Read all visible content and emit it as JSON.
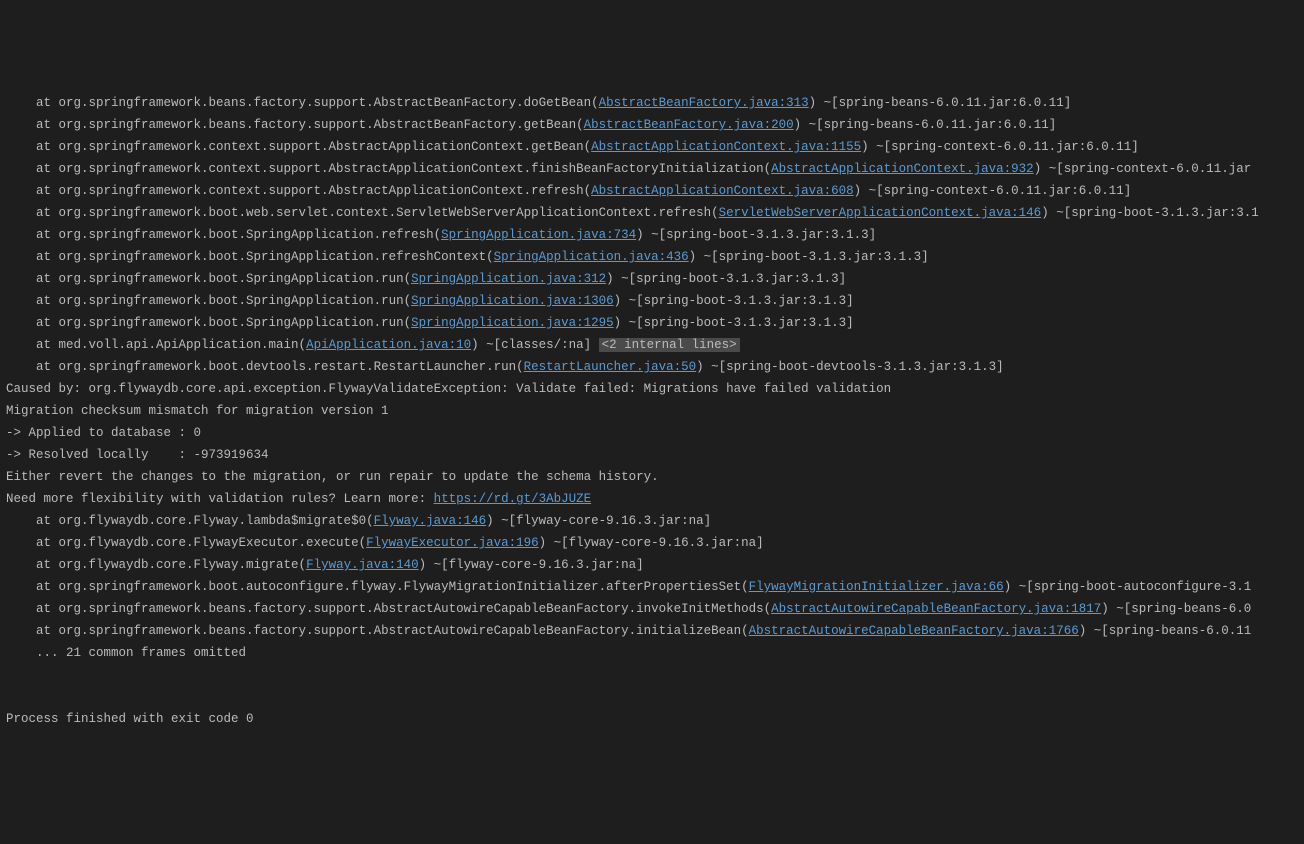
{
  "stacktrace": [
    {
      "indent": "    at ",
      "method": "org.springframework.beans.factory.support.AbstractBeanFactory.doGetBean(",
      "link": "AbstractBeanFactory.java:313",
      "suffix": ") ~[spring-beans-6.0.11.jar:6.0.11]"
    },
    {
      "indent": "    at ",
      "method": "org.springframework.beans.factory.support.AbstractBeanFactory.getBean(",
      "link": "AbstractBeanFactory.java:200",
      "suffix": ") ~[spring-beans-6.0.11.jar:6.0.11]"
    },
    {
      "indent": "    at ",
      "method": "org.springframework.context.support.AbstractApplicationContext.getBean(",
      "link": "AbstractApplicationContext.java:1155",
      "suffix": ") ~[spring-context-6.0.11.jar:6.0.11]"
    },
    {
      "indent": "    at ",
      "method": "org.springframework.context.support.AbstractApplicationContext.finishBeanFactoryInitialization(",
      "link": "AbstractApplicationContext.java:932",
      "suffix": ") ~[spring-context-6.0.11.jar"
    },
    {
      "indent": "    at ",
      "method": "org.springframework.context.support.AbstractApplicationContext.refresh(",
      "link": "AbstractApplicationContext.java:608",
      "suffix": ") ~[spring-context-6.0.11.jar:6.0.11]"
    },
    {
      "indent": "    at ",
      "method": "org.springframework.boot.web.servlet.context.ServletWebServerApplicationContext.refresh(",
      "link": "ServletWebServerApplicationContext.java:146",
      "suffix": ") ~[spring-boot-3.1.3.jar:3.1"
    },
    {
      "indent": "    at ",
      "method": "org.springframework.boot.SpringApplication.refresh(",
      "link": "SpringApplication.java:734",
      "suffix": ") ~[spring-boot-3.1.3.jar:3.1.3]"
    },
    {
      "indent": "    at ",
      "method": "org.springframework.boot.SpringApplication.refreshContext(",
      "link": "SpringApplication.java:436",
      "suffix": ") ~[spring-boot-3.1.3.jar:3.1.3]"
    },
    {
      "indent": "    at ",
      "method": "org.springframework.boot.SpringApplication.run(",
      "link": "SpringApplication.java:312",
      "suffix": ") ~[spring-boot-3.1.3.jar:3.1.3]"
    },
    {
      "indent": "    at ",
      "method": "org.springframework.boot.SpringApplication.run(",
      "link": "SpringApplication.java:1306",
      "suffix": ") ~[spring-boot-3.1.3.jar:3.1.3]"
    },
    {
      "indent": "    at ",
      "method": "org.springframework.boot.SpringApplication.run(",
      "link": "SpringApplication.java:1295",
      "suffix": ") ~[spring-boot-3.1.3.jar:3.1.3]"
    }
  ],
  "mainLine": {
    "indent": "    at ",
    "method": "med.voll.api.ApiApplication.main(",
    "link": "ApiApplication.java:10",
    "suffix": ") ~[classes/:na] ",
    "collapsed": "<2 internal lines>"
  },
  "restartLine": {
    "indent": "    at ",
    "method": "org.springframework.boot.devtools.restart.RestartLauncher.run(",
    "link": "RestartLauncher.java:50",
    "suffix": ") ~[spring-boot-devtools-3.1.3.jar:3.1.3]"
  },
  "causedBy": [
    "Caused by: org.flywaydb.core.api.exception.FlywayValidateException: Validate failed: Migrations have failed validation",
    "Migration checksum mismatch for migration version 1",
    "-> Applied to database : 0",
    "-> Resolved locally    : -973919634",
    "Either revert the changes to the migration, or run repair to update the schema history."
  ],
  "learnMore": {
    "prefix": "Need more flexibility with validation rules? Learn more: ",
    "url": "https://rd.gt/3AbJUZE"
  },
  "causedStack": [
    {
      "indent": "    at ",
      "method": "org.flywaydb.core.Flyway.lambda$migrate$0(",
      "link": "Flyway.java:146",
      "suffix": ") ~[flyway-core-9.16.3.jar:na]"
    },
    {
      "indent": "    at ",
      "method": "org.flywaydb.core.FlywayExecutor.execute(",
      "link": "FlywayExecutor.java:196",
      "suffix": ") ~[flyway-core-9.16.3.jar:na]"
    },
    {
      "indent": "    at ",
      "method": "org.flywaydb.core.Flyway.migrate(",
      "link": "Flyway.java:140",
      "suffix": ") ~[flyway-core-9.16.3.jar:na]"
    },
    {
      "indent": "    at ",
      "method": "org.springframework.boot.autoconfigure.flyway.FlywayMigrationInitializer.afterPropertiesSet(",
      "link": "FlywayMigrationInitializer.java:66",
      "suffix": ") ~[spring-boot-autoconfigure-3.1"
    },
    {
      "indent": "    at ",
      "method": "org.springframework.beans.factory.support.AbstractAutowireCapableBeanFactory.invokeInitMethods(",
      "link": "AbstractAutowireCapableBeanFactory.java:1817",
      "suffix": ") ~[spring-beans-6.0"
    },
    {
      "indent": "    at ",
      "method": "org.springframework.beans.factory.support.AbstractAutowireCapableBeanFactory.initializeBean(",
      "link": "AbstractAutowireCapableBeanFactory.java:1766",
      "suffix": ") ~[spring-beans-6.0.11"
    }
  ],
  "omitted": "    ... 21 common frames omitted",
  "exitLine": "Process finished with exit code 0"
}
